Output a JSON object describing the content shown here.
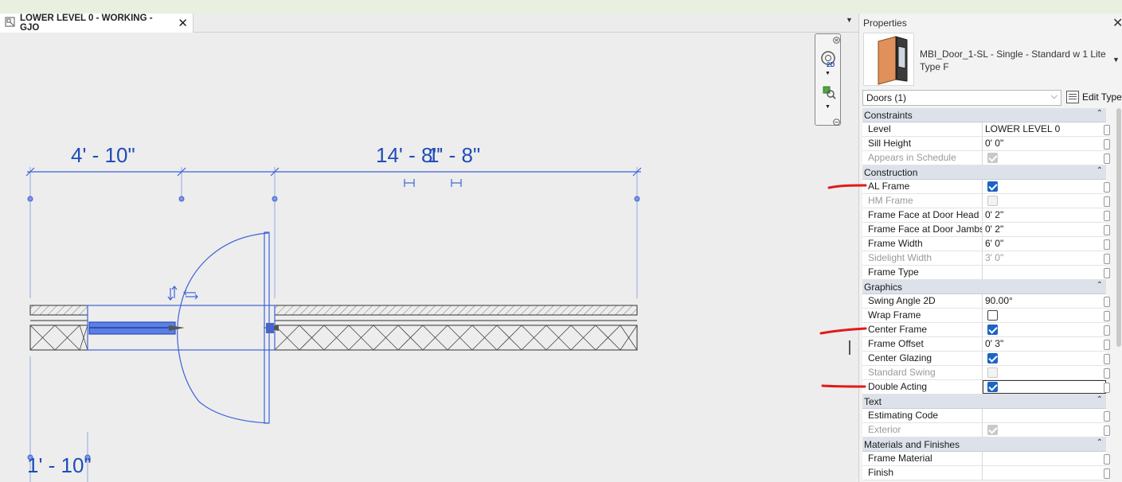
{
  "view_tab": {
    "title": "LOWER LEVEL 0 - WORKING - GJO",
    "close_glyph": "✕",
    "menu_glyph": "▼"
  },
  "canvas": {
    "dimensions": {
      "top_left": "4' - 10\"",
      "top_right_a": "14' - 8\"",
      "top_right_b": "1' - 8\"",
      "bottom_left": "1' - 10\""
    },
    "line_color": "#3d63d9",
    "dim_color": "#1f4db8"
  },
  "nav_bar": {
    "label_2d": "2D"
  },
  "properties": {
    "title": "Properties",
    "close_glyph": "✕",
    "type_line1": "MBI_Door_1-SL - Single - Standard w 1 Lite",
    "type_line2": "Type F",
    "category": "Doors (1)",
    "edit_type": "Edit Type",
    "groups": [
      {
        "name": "Constraints",
        "rows": [
          {
            "label": "Level",
            "value": "LOWER LEVEL 0"
          },
          {
            "label": "Sill Height",
            "value": "0'  0\""
          },
          {
            "label": "Appears in Schedule",
            "checkbox": true,
            "checked": true,
            "disabled": true
          }
        ]
      },
      {
        "name": "Construction",
        "rows": [
          {
            "label": "AL Frame",
            "checkbox": true,
            "checked": true
          },
          {
            "label": "HM Frame",
            "checkbox": true,
            "checked": false,
            "disabled": true
          },
          {
            "label": "Frame Face at Door Head",
            "value": "0'  2\""
          },
          {
            "label": "Frame Face at Door Jambs",
            "value": "0'  2\""
          },
          {
            "label": "Frame Width",
            "value": "6'  0\""
          },
          {
            "label": "Sidelight Width",
            "value": "3'  0\"",
            "disabled": true
          },
          {
            "label": "Frame Type",
            "value": ""
          }
        ]
      },
      {
        "name": "Graphics",
        "rows": [
          {
            "label": "Swing Angle 2D",
            "value": "90.00°"
          },
          {
            "label": "Wrap Frame",
            "checkbox": true,
            "checked": false
          },
          {
            "label": "Center Frame",
            "checkbox": true,
            "checked": true
          },
          {
            "label": "Frame Offset",
            "value": "0'  3\""
          },
          {
            "label": "Center Glazing",
            "checkbox": true,
            "checked": true
          },
          {
            "label": "Standard Swing",
            "checkbox": true,
            "checked": false,
            "disabled": true
          },
          {
            "label": "Double Acting",
            "checkbox": true,
            "checked": true,
            "selected": true
          }
        ]
      },
      {
        "name": "Text",
        "rows": [
          {
            "label": "Estimating Code",
            "value": ""
          },
          {
            "label": "Exterior",
            "checkbox": true,
            "checked": true,
            "disabled": true
          }
        ]
      },
      {
        "name": "Materials and Finishes",
        "rows": [
          {
            "label": "Frame Material",
            "value": ""
          },
          {
            "label": "Finish",
            "value": ""
          }
        ]
      }
    ],
    "collapse_glyph": "⌃"
  },
  "colors": {
    "accent": "#1b64c6",
    "annotation": "#e01b1b"
  }
}
